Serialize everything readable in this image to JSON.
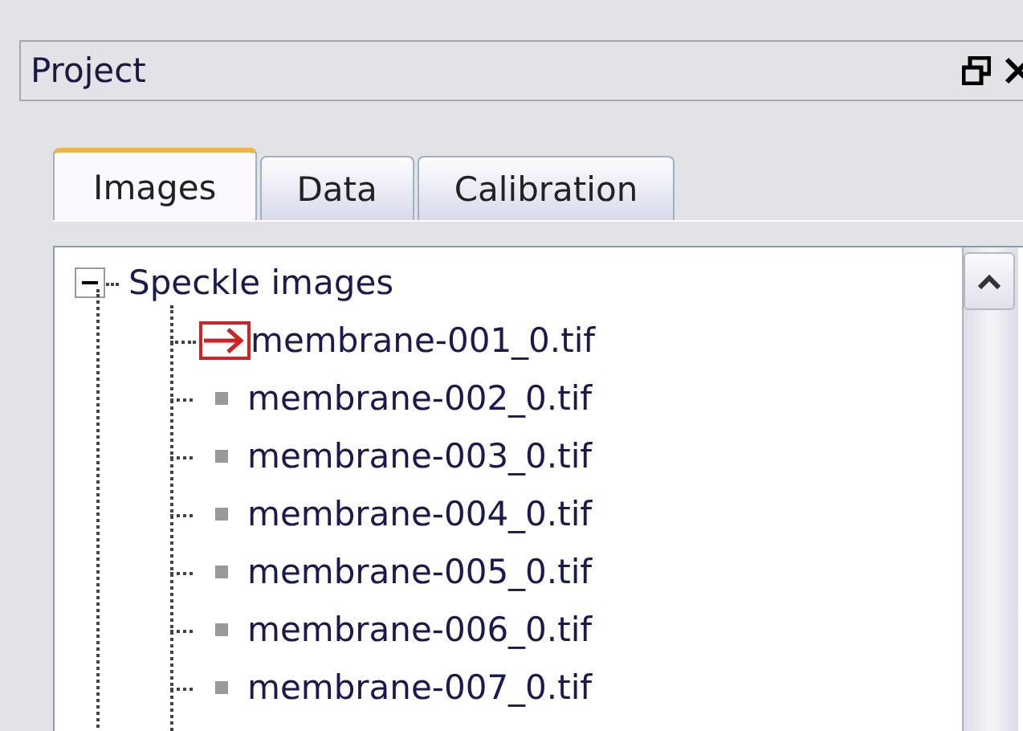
{
  "panel": {
    "title": "Project"
  },
  "tabs": [
    {
      "label": "Images",
      "selected": true
    },
    {
      "label": "Data",
      "selected": false
    },
    {
      "label": "Calibration",
      "selected": false
    }
  ],
  "tree": [
    {
      "label": "Speckle images",
      "expanded": true,
      "children": [
        {
          "label": "membrane-001_0.tif",
          "current": true
        },
        {
          "label": "membrane-002_0.tif",
          "current": false
        },
        {
          "label": "membrane-003_0.tif",
          "current": false
        },
        {
          "label": "membrane-004_0.tif",
          "current": false
        },
        {
          "label": "membrane-005_0.tif",
          "current": false
        },
        {
          "label": "membrane-006_0.tif",
          "current": false
        },
        {
          "label": "membrane-007_0.tif",
          "current": false
        }
      ]
    }
  ]
}
